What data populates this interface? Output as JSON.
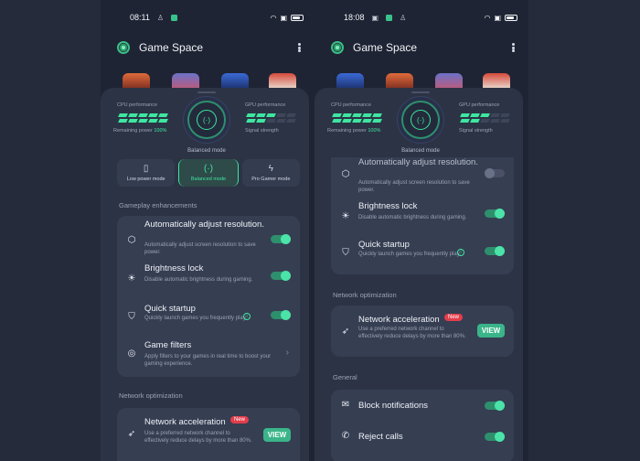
{
  "colors": {
    "accent": "#3ee6a0",
    "badge": "#e23d4b",
    "card": "#2c3345",
    "group": "#363e52"
  },
  "app": {
    "title": "Game Space"
  },
  "left": {
    "status": {
      "time": "08:11"
    },
    "performance": {
      "cpu_label": "CPU performance",
      "gpu_label": "GPU performance",
      "power_label": "Remaining power",
      "power_value": "100%",
      "signal_label": "Signal strength",
      "mode_label": "Balanced mode"
    },
    "modes": [
      {
        "label": "Low power mode",
        "icon": "battery-icon"
      },
      {
        "label": "Balanced mode",
        "icon": "balanced-icon"
      },
      {
        "label": "Pro Gamer mode",
        "icon": "lightning-icon"
      }
    ],
    "gameplay": {
      "title": "Gameplay enhancements",
      "items": [
        {
          "title": "Automatically adjust resolution.",
          "desc": "Automatically adjust screen resolution to save power.",
          "toggle": "on"
        },
        {
          "title": "Brightness lock",
          "desc": "Disable automatic brightness during gaming.",
          "toggle": "on"
        },
        {
          "title": "Quick startup",
          "desc": "Quickly launch games you frequently play.",
          "toggle": "on"
        },
        {
          "title": "Game filters",
          "desc": "Apply filters to your games in real time to boost your gaming experience."
        }
      ]
    },
    "network": {
      "title": "Network optimization",
      "item_title": "Network acceleration",
      "badge": "New",
      "desc": "Use a preferred network channel to effectively reduce delays by more than 80%.",
      "button": "VIEW"
    }
  },
  "right": {
    "status": {
      "time": "18:08"
    },
    "performance": {
      "cpu_label": "CPU performance",
      "gpu_label": "GPU performance",
      "power_label": "Remaining power",
      "power_value": "100%",
      "signal_label": "Signal strength",
      "mode_label": "Balanced mode"
    },
    "gameplay": {
      "items": [
        {
          "title": "Automatically adjust resolution.",
          "desc": "Automatically adjust screen resolution to save power.",
          "toggle": "off"
        },
        {
          "title": "Brightness lock",
          "desc": "Disable automatic brightness during gaming.",
          "toggle": "on"
        },
        {
          "title": "Quick startup",
          "desc": "Quickly launch games you frequently play.",
          "toggle": "on"
        }
      ]
    },
    "network": {
      "title": "Network optimization",
      "item_title": "Network acceleration",
      "badge": "New",
      "desc": "Use a preferred network channel to effectively reduce delays by more than 80%.",
      "button": "VIEW"
    },
    "general": {
      "title": "General",
      "items": [
        {
          "title": "Block notifications",
          "toggle": "on"
        },
        {
          "title": "Reject calls",
          "toggle": "on"
        }
      ]
    }
  }
}
